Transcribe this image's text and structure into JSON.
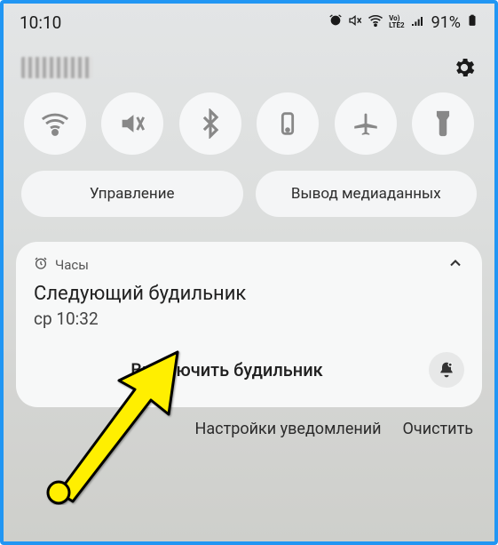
{
  "status": {
    "time": "10:10",
    "battery": "91%"
  },
  "qs": {
    "management": "Управление",
    "media_output": "Вывод медиаданных"
  },
  "notif": {
    "app": "Часы",
    "title": "Следующий будильник",
    "subtitle": "ср 10:32",
    "action": "Выключить будильник"
  },
  "footer": {
    "settings": "Настройки уведомлений",
    "clear": "Очистить"
  }
}
